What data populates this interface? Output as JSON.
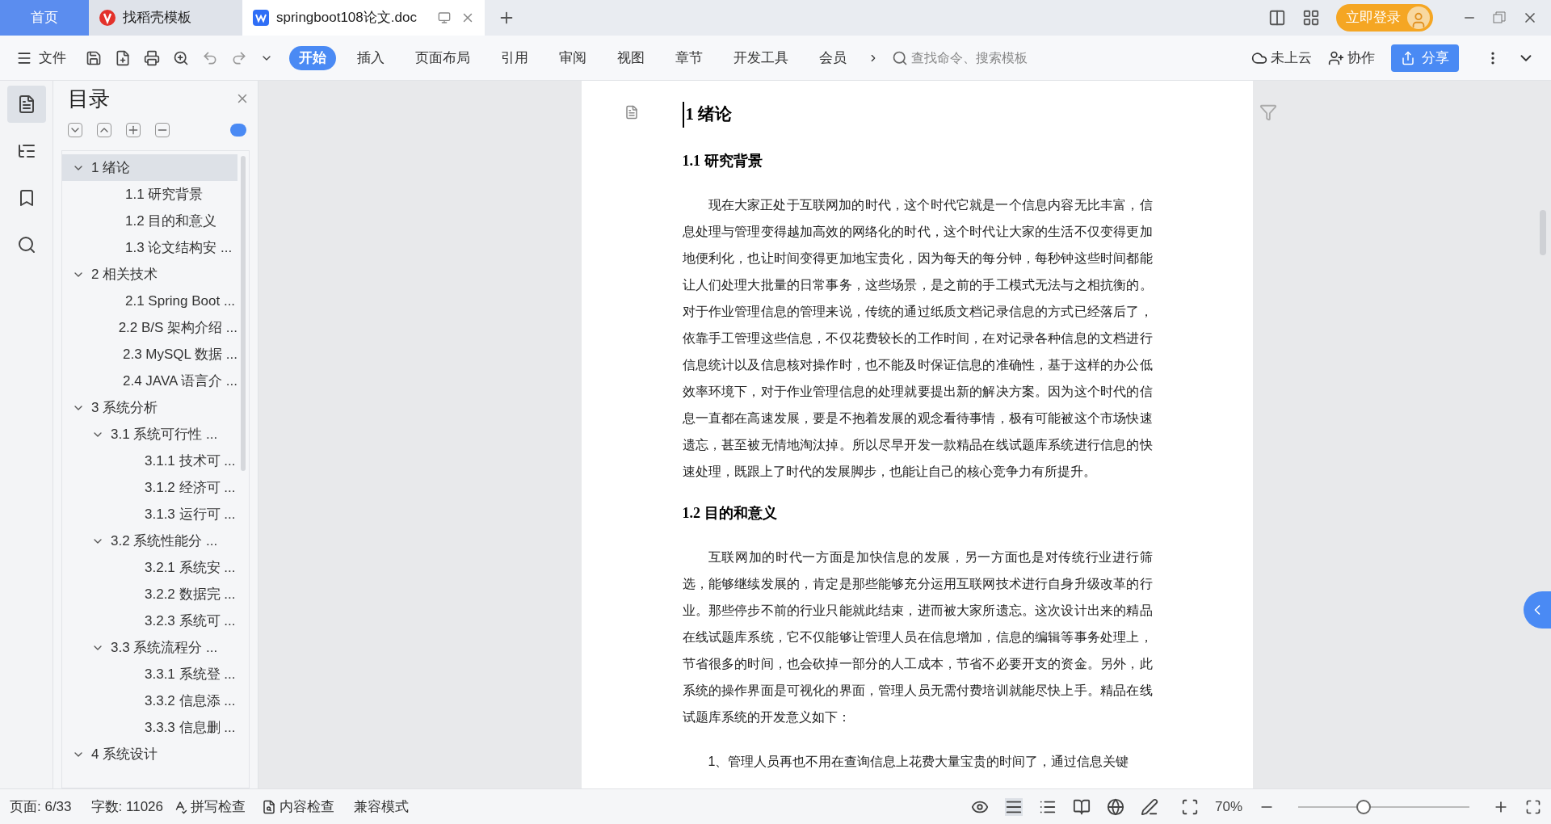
{
  "title_bar": {
    "tabs": [
      {
        "kind": "home",
        "label": "首页",
        "selected": false
      },
      {
        "kind": "template",
        "label": "找稻壳模板",
        "selected": false
      },
      {
        "kind": "document",
        "label": "springboot108论文.doc",
        "selected": true
      }
    ],
    "login_button": "立即登录"
  },
  "toolbar": {
    "file_menu": "文件",
    "tabs": [
      {
        "label": "开始",
        "selected": true
      },
      {
        "label": "插入",
        "selected": false
      },
      {
        "label": "页面布局",
        "selected": false
      },
      {
        "label": "引用",
        "selected": false
      },
      {
        "label": "审阅",
        "selected": false
      },
      {
        "label": "视图",
        "selected": false
      },
      {
        "label": "章节",
        "selected": false
      },
      {
        "label": "开发工具",
        "selected": false
      },
      {
        "label": "会员",
        "selected": false
      }
    ],
    "search": {
      "placeholder": "查找命令、搜索模板"
    },
    "cloud": "未上云",
    "collaborate": "协作",
    "share": "分享"
  },
  "side_panel_icons": [
    {
      "kind": "toc",
      "selected": true
    },
    {
      "kind": "navigation",
      "selected": false
    },
    {
      "kind": "bookmark",
      "selected": false
    },
    {
      "kind": "search",
      "selected": false
    }
  ],
  "sidebar": {
    "title": "目录",
    "toc": [
      {
        "label": "1  绪论",
        "selected": true,
        "expanded": true,
        "children": [
          {
            "label": "1.1  研究背景",
            "selected": false
          },
          {
            "label": "1.2 目的和意义",
            "selected": false
          },
          {
            "label": "1.3  论文结构安 ...",
            "selected": false
          }
        ]
      },
      {
        "label": "2  相关技术",
        "selected": false,
        "expanded": true,
        "children": [
          {
            "label": "2.1 Spring Boot  ...",
            "selected": false
          },
          {
            "label": "2.2 B/S 架构介绍 ...",
            "selected": false
          },
          {
            "label": "2.3 MySQL 数据 ...",
            "selected": false
          },
          {
            "label": "2.4 JAVA 语言介 ...",
            "selected": false
          }
        ]
      },
      {
        "label": "3  系统分析",
        "selected": false,
        "expanded": true,
        "children": [
          {
            "label": "3.1 系统可行性 ...",
            "selected": false,
            "expanded": true,
            "children": [
              {
                "label": "3.1.1  技术可 ...",
                "selected": false
              },
              {
                "label": "3.1.2  经济可 ...",
                "selected": false
              },
              {
                "label": "3.1.3  运行可 ...",
                "selected": false
              }
            ]
          },
          {
            "label": "3.2 系统性能分 ...",
            "selected": false,
            "expanded": true,
            "children": [
              {
                "label": "3.2.1  系统安 ...",
                "selected": false
              },
              {
                "label": "3.2.2  数据完 ...",
                "selected": false
              },
              {
                "label": "3.2.3 系统可 ...",
                "selected": false
              }
            ]
          },
          {
            "label": "3.3 系统流程分 ...",
            "selected": false,
            "expanded": true,
            "children": [
              {
                "label": "3.3.1 系统登 ...",
                "selected": false
              },
              {
                "label": "3.3.2 信息添 ...",
                "selected": false
              },
              {
                "label": "3.3.3 信息删 ...",
                "selected": false
              }
            ]
          }
        ]
      },
      {
        "label": "4  系统设计",
        "selected": false,
        "expanded": true
      }
    ]
  },
  "document": {
    "blocks": [
      {
        "kind": "heading1",
        "text": "1  绪论"
      },
      {
        "kind": "heading2",
        "text": "1.1  研究背景"
      },
      {
        "kind": "paragraph",
        "text": "现在大家正处于互联网加的时代，这个时代它就是一个信息内容无比丰富，信息处理与管理变得越加高效的网络化的时代，这个时代让大家的生活不仅变得更加地便利化，也让时间变得更加地宝贵化，因为每天的每分钟，每秒钟这些时间都能让人们处理大批量的日常事务，这些场景，是之前的手工模式无法与之相抗衡的。对于作业管理信息的管理来说，传统的通过纸质文档记录信息的方式已经落后了，依靠手工管理这些信息，不仅花费较长的工作时间，在对记录各种信息的文档进行信息统计以及信息核对操作时，也不能及时保证信息的准确性，基于这样的办公低效率环境下，对于作业管理信息的处理就要提出新的解决方案。因为这个时代的信息一直都在高速发展，要是不抱着发展的观念看待事情，极有可能被这个市场快速遗忘，甚至被无情地淘汰掉。所以尽早开发一款精品在线试题库系统进行信息的快速处理，既跟上了时代的发展脚步，也能让自己的核心竞争力有所提升。"
      },
      {
        "kind": "heading2",
        "text": "1.2 目的和意义"
      },
      {
        "kind": "paragraph",
        "text": "互联网加的时代一方面是加快信息的发展，另一方面也是对传统行业进行筛选，能够继续发展的，肯定是那些能够充分运用互联网技术进行自身升级改革的行业。那些停步不前的行业只能就此结束，进而被大家所遗忘。这次设计出来的精品在线试题库系统，它不仅能够让管理人员在信息增加，信息的编辑等事务处理上，节省很多的时间，也会砍掉一部分的人工成本，节省不必要开支的资金。另外，此系统的操作界面是可视化的界面，管理人员无需付费培训就能尽快上手。精品在线试题库系统的开发意义如下："
      },
      {
        "kind": "paragraph",
        "text": "1、管理人员再也不用在查询信息上花费大量宝贵的时间了，通过信息关键"
      }
    ]
  },
  "status_bar": {
    "page": "页面: 6/33",
    "words": "字数: 11026",
    "spell_check": "拼写检查",
    "content_check": "内容检查",
    "mode": "兼容模式",
    "zoom": "70%",
    "zoom_slider": {
      "level": 0.38
    }
  }
}
